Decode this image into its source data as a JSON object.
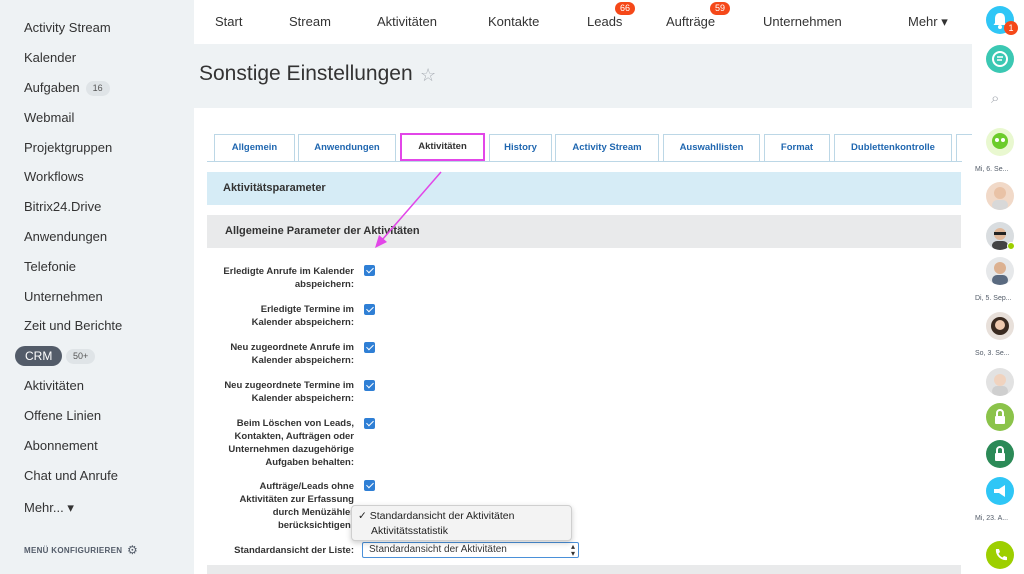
{
  "sidebar": {
    "items": [
      {
        "label": "Activity Stream"
      },
      {
        "label": "Kalender"
      },
      {
        "label": "Aufgaben",
        "badge": "16"
      },
      {
        "label": "Webmail"
      },
      {
        "label": "Projektgruppen"
      },
      {
        "label": "Workflows"
      },
      {
        "label": "Bitrix24.Drive"
      },
      {
        "label": "Anwendungen"
      },
      {
        "label": "Telefonie"
      },
      {
        "label": "Unternehmen"
      },
      {
        "label": "Zeit und Berichte"
      },
      {
        "label": "CRM",
        "badge": "50+"
      },
      {
        "label": "Aktivitäten"
      },
      {
        "label": "Offene Linien"
      },
      {
        "label": "Abonnement"
      },
      {
        "label": "Chat und Anrufe"
      },
      {
        "label": "Mehr... ▾"
      }
    ],
    "footer": "MENÜ KONFIGURIEREN"
  },
  "topnav": {
    "items": [
      {
        "label": "Start"
      },
      {
        "label": "Stream"
      },
      {
        "label": "Aktivitäten"
      },
      {
        "label": "Kontakte"
      },
      {
        "label": "Leads",
        "badge": "66"
      },
      {
        "label": "Aufträge",
        "badge": "59"
      },
      {
        "label": "Unternehmen"
      },
      {
        "label": "Mehr ▾"
      }
    ]
  },
  "page": {
    "title": "Sonstige Einstellungen",
    "star": "☆"
  },
  "tabs": [
    {
      "label": "Allgemein"
    },
    {
      "label": "Anwendungen"
    },
    {
      "label": "Aktivitäten",
      "active": true
    },
    {
      "label": "History"
    },
    {
      "label": "Activity Stream"
    },
    {
      "label": "Auswahllisten"
    },
    {
      "label": "Format"
    },
    {
      "label": "Dublettenkontrolle"
    }
  ],
  "sections": {
    "header": "Aktivitätsparameter",
    "subheader": "Allgemeine Parameter der Aktivitäten"
  },
  "settings": [
    {
      "label_lines": [
        "Erledigte Anrufe im Kalender",
        "abspeichern:"
      ],
      "checked": true
    },
    {
      "label_lines": [
        "Erledigte Termine im",
        "Kalender abspeichern:"
      ],
      "checked": true
    },
    {
      "label_lines": [
        "Neu zugeordnete Anrufe im",
        "Kalender abspeichern:"
      ],
      "checked": true
    },
    {
      "label_lines": [
        "Neu zugeordnete Termine im",
        "Kalender abspeichern:"
      ],
      "checked": true
    },
    {
      "label_lines": [
        "Beim Löschen von Leads,",
        "Kontakten, Aufträgen oder",
        "Unternehmen dazugehörige",
        "Aufgaben behalten:"
      ],
      "checked": true
    },
    {
      "label_lines": [
        "Aufträge/Leads ohne",
        "Aktivitäten zur Erfassung",
        "durch Menüzähler",
        "berücksichtigen:"
      ],
      "checked": true
    }
  ],
  "list_view": {
    "label": "Standardansicht der Liste:",
    "value": "Standardansicht der Aktivitäten",
    "options": [
      "✓ Standardansicht der Aktivitäten",
      "Aktivitätsstatistik"
    ]
  },
  "rightbar": {
    "notification_count": "1",
    "dates": [
      "Mi, 6. Se...",
      "Di, 5. Sep...",
      "So, 3. Se...",
      "Mi, 23. A..."
    ]
  },
  "colors": {
    "accent": "#2f7fd5",
    "highlight": "#e246e8",
    "badge": "#f54819",
    "green": "#3bc8b3"
  }
}
